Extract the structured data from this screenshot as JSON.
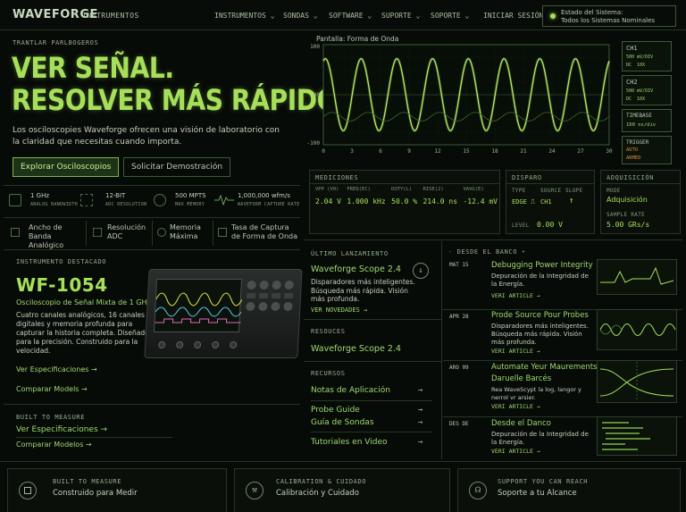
{
  "nav": {
    "brand": "WAVEFORGE",
    "brand_sub": "INSTRUMENTOS",
    "items": [
      {
        "label": "INSTRUMENTOS ⌄"
      },
      {
        "label": "SONDAS ⌄"
      },
      {
        "label": "SOFTWARE ⌄"
      },
      {
        "label": "SUPORTE ⌄"
      },
      {
        "label": "SOPORTE ⌄"
      },
      {
        "label": "INICIAR SESIÓN"
      }
    ],
    "status_line1": "Estado del Sistema:",
    "status_line2": "Todos los Sistemas Nominales"
  },
  "hero": {
    "eyebrow": "TRANTLAR PARLBOGEROS",
    "title_line1": "VER SEÑAL.",
    "title_line2": "RESOLVER MÁS RÁPIDO.",
    "desc": "Los osciloscopies Waveforge ofrecen una visión de laboratorio con la claridad que necesitas cuando importa.",
    "primary_btn": "Explorar Osciloscopios",
    "secondary_btn": "Solicitar Demostración"
  },
  "specs": [
    {
      "value": "1 GHz",
      "label": "ANALOG BANDWIDTH"
    },
    {
      "value": "12-BIT",
      "label": "ADC RESOLUTION"
    },
    {
      "value": "500 MPTS",
      "label": "MAX MEMORY"
    },
    {
      "value": "1,000,000 wfm/s",
      "label": "WAVEFORM CAPTURE RATE"
    }
  ],
  "spec_labels": [
    "Ancho de Banda Analógico",
    "Resolución ADC",
    "Memoria Máxima",
    "Tasa de Captura de Forma de Onda"
  ],
  "featured": {
    "eyebrow": "INSTRUMENTO DESTACADO",
    "model": "WF-1054",
    "subtitle": "Osciloscopio de Señal Mixta de 1 GHz.",
    "desc": "Cuatro canales analógicos, 16 canales digitales y memoria profunda para capturar la historia completa. Diseñado para la precisión. Construido para la velocidad.",
    "link1": "Ver Especificaciones →",
    "link2": "Comparar Models →"
  },
  "built": {
    "eyebrow": "BUILT TO MEASURE",
    "link1": "Ver Especificaciones →",
    "link2": "Comparar Modelos →"
  },
  "scope": {
    "label": "Pantalla: Forma de Onda",
    "y_ticks": [
      "100",
      "00",
      "-100"
    ],
    "x_ticks": [
      "0",
      "3",
      "6",
      "9",
      "12",
      "15",
      "18",
      "21",
      "24",
      "27",
      "30"
    ],
    "channels": [
      {
        "name": "CH1",
        "l1": "500 mV/DIV",
        "l2": "DC  10X"
      },
      {
        "name": "CH2",
        "l1": "500 mV/DIV",
        "l2": "DC  10X"
      }
    ],
    "timebase": {
      "name": "TIMEBASE",
      "l1": "100 ns/div"
    },
    "trigger": {
      "name": "TRIGGER",
      "l1": "AUTO",
      "l2": "ARMED"
    }
  },
  "measure": {
    "title": "MEDICIONES",
    "cols": [
      {
        "k": "VPP (V0)",
        "v": "2.04 V"
      },
      {
        "k": "FREQ(EC)",
        "v": "1.000 kHz"
      },
      {
        "k": "DUTY(L)",
        "v": "50.0 %"
      },
      {
        "k": "RISE(2)",
        "v": "214.0 ns"
      },
      {
        "k": "VAVG(E)",
        "v": "-12.4 mV"
      }
    ]
  },
  "disparo": {
    "title": "DISPARO",
    "type_k": "TYPE",
    "type_v": "EDGE ⎍",
    "source_k": "SOURCE",
    "source_v": "CH1",
    "slope_k": "SLOPE",
    "slope_v": "↑",
    "level_k": "LEVEL",
    "level_v": "0.00 V"
  },
  "acq": {
    "title": "ADQUISICIÓN",
    "mode_k": "MODE",
    "mode_v": "Adquisición",
    "rate_k": "SAMPLE RATE",
    "rate_v": "5.00 GRs/s"
  },
  "launch": {
    "eyebrow": "ÚLTIMO LANZAMIENTO",
    "title": "Waveforge Scope 2.4",
    "desc": "Disparadores más inteligentes. Búsqueda más rápida. Visión más profunda.",
    "link": "VER NOVEDADES →"
  },
  "resources": {
    "eyebrow": "RESOUCES",
    "title": "Waveforge Scope 2.4"
  },
  "recursos": {
    "eyebrow": "RECURSOS",
    "items": [
      {
        "label": "Notas de Aplicación",
        "arrow": "→"
      },
      {
        "label": "Probe Guide",
        "arrow": "→"
      },
      {
        "label": "Guía de Sondas",
        "arrow": "→"
      },
      {
        "label": "Tutoriales en Video",
        "arrow": "→"
      }
    ]
  },
  "blog": {
    "eyebrow": "DESDE EL BANCO",
    "posts": [
      {
        "date": "MAT 15",
        "title": "Debugging Power Integrity",
        "desc": "Depuración de la Integridad de la Energía.",
        "link": "VERI ARTICLE →"
      },
      {
        "date": "APR 28",
        "title": "Prode Source Pour Probes",
        "desc": "Disparadores más inteligentes. Búsqueda más rápida. Visión más profunda.",
        "link": "VERI ARTICLE →"
      },
      {
        "date": "ARO 09",
        "title": "Automate Yeur Maurements",
        "title2": "Daruelle Barcés",
        "desc": "Rea WaveScypt la log, langor y nerrol vr arsier.",
        "link": "VERI ARTICLE →"
      },
      {
        "date": "DES DE",
        "title": "Desde el Danco",
        "desc": "Depuración de la Integridad de la Energía.",
        "link": "VERI ARTICLE →"
      }
    ]
  },
  "footer_cards": [
    {
      "eyebrow": "BUILT TO MEASURE",
      "title": "Construido para Medir"
    },
    {
      "eyebrow": "CALIBRATION & CUIDADO",
      "title": "Calibración y Cuidado"
    },
    {
      "eyebrow": "SUPPORT YOU CAN REACH",
      "title": "Soporte a tu Alcance"
    }
  ],
  "colors": {
    "accent": "#a6e05a",
    "bg": "#070b07",
    "border": "#253625"
  }
}
